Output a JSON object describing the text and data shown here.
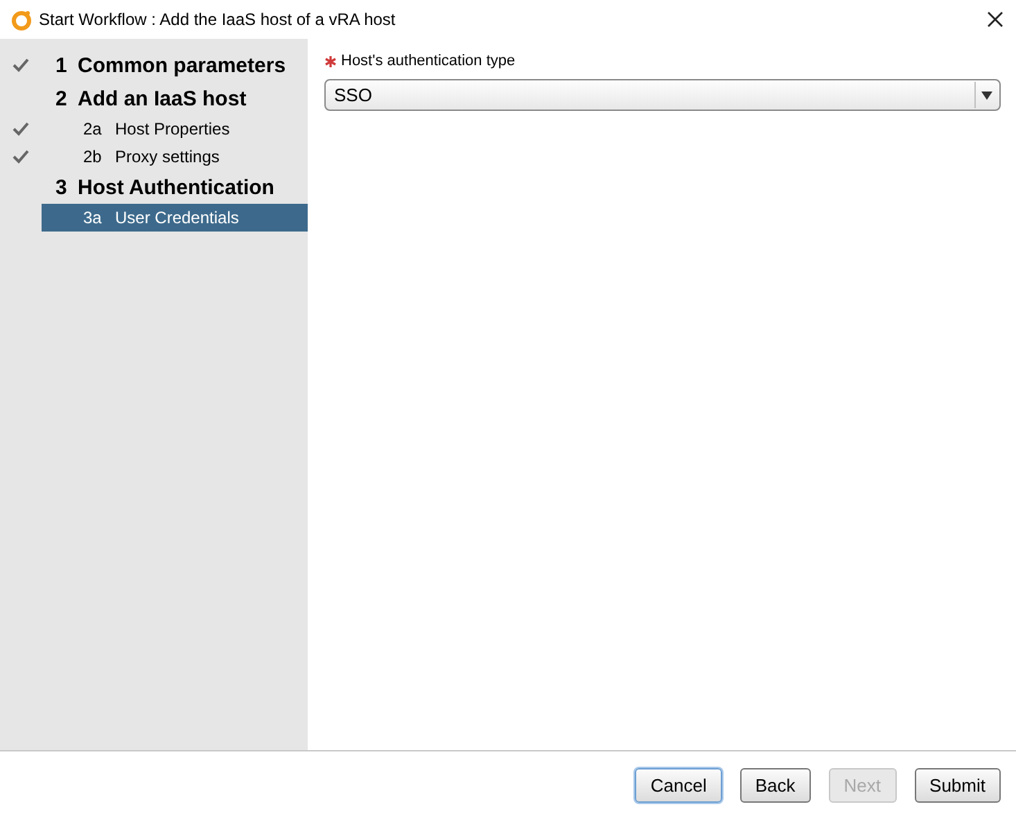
{
  "window": {
    "title": "Start Workflow : Add the IaaS host of a vRA host"
  },
  "steps": [
    {
      "number": "1",
      "label": "Common parameters",
      "done": true,
      "selected": false
    },
    {
      "number": "2",
      "label": "Add an IaaS host",
      "done": false,
      "selected": false,
      "children": [
        {
          "number": "2a",
          "label": "Host Properties",
          "done": true,
          "selected": false
        },
        {
          "number": "2b",
          "label": "Proxy settings",
          "done": true,
          "selected": false
        }
      ]
    },
    {
      "number": "3",
      "label": "Host Authentication",
      "done": false,
      "selected": false,
      "children": [
        {
          "number": "3a",
          "label": "User Credentials",
          "done": false,
          "selected": true
        }
      ]
    }
  ],
  "field": {
    "label": "Host's authentication type",
    "required": true,
    "value": "SSO"
  },
  "buttons": [
    {
      "label": "Cancel",
      "disabled": false,
      "focused": true
    },
    {
      "label": "Back",
      "disabled": false,
      "focused": false
    },
    {
      "label": "Next",
      "disabled": true,
      "focused": false
    },
    {
      "label": "Submit",
      "disabled": false,
      "focused": false
    }
  ]
}
